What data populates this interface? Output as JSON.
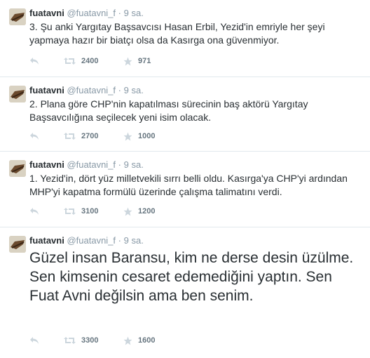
{
  "colors": {
    "text": "#292f33",
    "secondary": "#8899a6",
    "border": "#e1e8ed"
  },
  "tweets": [
    {
      "fullname": "fuatavni",
      "username": "@fuatavni_f",
      "dot": "·",
      "time": "9 sa.",
      "text": "3. Şu anki Yargıtay Başsavcısı Hasan Erbil, Yezid'in emriyle her şeyi yapmaya hazır bir biatçı olsa da Kasırga ona güvenmiyor.",
      "retweets": "2400",
      "favorites": "971"
    },
    {
      "fullname": "fuatavni",
      "username": "@fuatavni_f",
      "dot": "·",
      "time": "9 sa.",
      "text": "2. Plana göre CHP'nin kapatılması sürecinin baş aktörü Yargıtay Başsavcılığına seçilecek yeni isim olacak.",
      "retweets": "2700",
      "favorites": "1000"
    },
    {
      "fullname": "fuatavni",
      "username": "@fuatavni_f",
      "dot": "·",
      "time": "9 sa.",
      "text": "1. Yezid'in, dört yüz milletvekili sırrı belli oldu. Kasırga'ya CHP'yi ardından MHP'yi kapatma formülü üzerinde çalışma talimatını verdi.",
      "retweets": "3100",
      "favorites": "1200"
    },
    {
      "fullname": "fuatavni",
      "username": "@fuatavni_f",
      "dot": "·",
      "time": "9 sa.",
      "text": "Güzel insan Baransu, kim ne derse desin üzülme. Sen kimsenin cesaret edemediğini yaptın. Sen Fuat Avni değilsin ama ben senim.",
      "retweets": "3300",
      "favorites": "1600"
    }
  ]
}
